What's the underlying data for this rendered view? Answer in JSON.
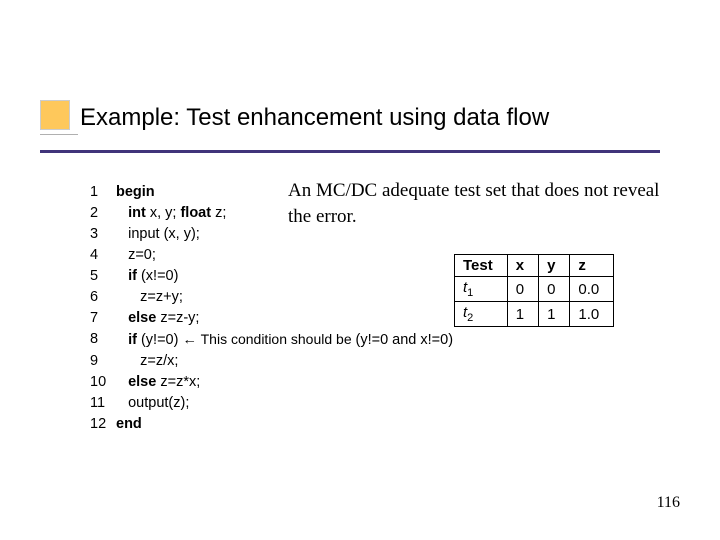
{
  "title": "Example: Test enhancement using data flow",
  "body_text": "An  MC/DC adequate test set that does not reveal the error.",
  "code": {
    "lines": [
      {
        "n": "1",
        "indent": "",
        "text": "begin",
        "bold": true
      },
      {
        "n": "2",
        "indent": "   ",
        "text_prefix_bold": "int",
        "text_mid": " x, y; ",
        "text_bold2": "float",
        "text_after": " z;"
      },
      {
        "n": "3",
        "indent": "   ",
        "text": "input (x, y);"
      },
      {
        "n": "4",
        "indent": "   ",
        "text": "z=0;"
      },
      {
        "n": "5",
        "indent": "   ",
        "text_prefix_bold": "if",
        "text_after": " (x!=0)"
      },
      {
        "n": "6",
        "indent": "      ",
        "text": "z=z+y;"
      },
      {
        "n": "7",
        "indent": "   ",
        "text_prefix_bold": "else",
        "text_after": " z=z-y;"
      },
      {
        "n": "8",
        "indent": "   ",
        "text_prefix_bold": "if",
        "text_mid": " (y!=0) ",
        "arrow": "←",
        "note": " This condition should be ",
        "cond": "(y!=0 and x!=0)"
      },
      {
        "n": "9",
        "indent": "      ",
        "text": "z=z/x;"
      },
      {
        "n": "10",
        "indent": "   ",
        "text_prefix_bold": "else",
        "text_after": " z=z*x;"
      },
      {
        "n": "11",
        "indent": "   ",
        "text": "output(z);"
      },
      {
        "n": "12",
        "indent": "",
        "text": "end",
        "bold": true
      }
    ]
  },
  "table": {
    "headers": [
      "Test",
      "x",
      "y",
      "z"
    ],
    "rows": [
      {
        "name": "t",
        "sub": "1",
        "x": "0",
        "y": "0",
        "z": "0.0"
      },
      {
        "name": "t",
        "sub": "2",
        "x": "1",
        "y": "1",
        "z": "1.0"
      }
    ]
  },
  "page_number": "116",
  "chart_data": {
    "type": "table",
    "title": "MC/DC adequate test set",
    "columns": [
      "Test",
      "x",
      "y",
      "z"
    ],
    "rows": [
      [
        "t1",
        0,
        0,
        0.0
      ],
      [
        "t2",
        1,
        1,
        1.0
      ]
    ]
  }
}
